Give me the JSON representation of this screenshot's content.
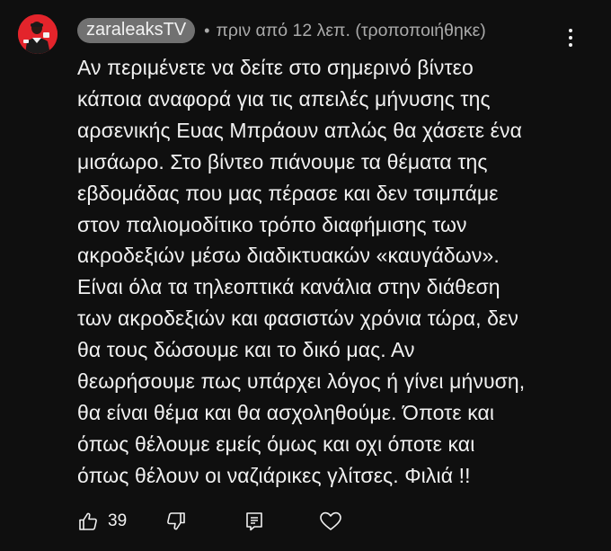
{
  "comment": {
    "author": "zaraleaksTV",
    "separator": "•",
    "time": "πριν από 12 λεπ. (τροποποιήθηκε)",
    "text": "Αν περιμένετε να δείτε στο σημερινό βίντεο\nκάποια αναφορά για τις απειλές μήνυσης της\nαρσενικής Ευας Μπράουν απλώς θα χάσετε ένα\nμισάωρο. Στο βίντεο πιάνουμε τα θέματα της\nεβδομάδας που μας πέρασε και δεν τσιμπάμε\nστον παλιομοδίτικο τρόπο διαφήμισης των\nακροδεξιών  μέσω διαδικτυακών «καυγάδων».\nΕίναι όλα τα τηλεοπτικά κανάλια στην διάθεση\nτων ακροδεξιών και φασιστών χρόνια τώρα, δεν\nθα τους δώσουμε και το δικό μας. Αν\nθεωρήσουμε πως υπάρχει λόγος ή γίνει μήνυση,\nθα είναι θέμα και θα ασχοληθούμε. Όποτε και\nόπως θέλουμε εμείς όμως και οχι όποτε και\nόπως θέλουν οι ναζιάρικες γλίτσες. Φιλιά !!",
    "like_count": "39"
  },
  "icons": {
    "avatar": "channel-avatar",
    "menu": "more-vertical-icon",
    "like": "thumbs-up-icon",
    "dislike": "thumbs-down-icon",
    "reply": "reply-icon",
    "heart": "heart-icon"
  },
  "colors": {
    "background": "#0f0f0f",
    "text": "#f1f1f1",
    "secondary_text": "#aaaaaa",
    "author_chip": "#717171",
    "avatar_bg": "#e3242b"
  }
}
